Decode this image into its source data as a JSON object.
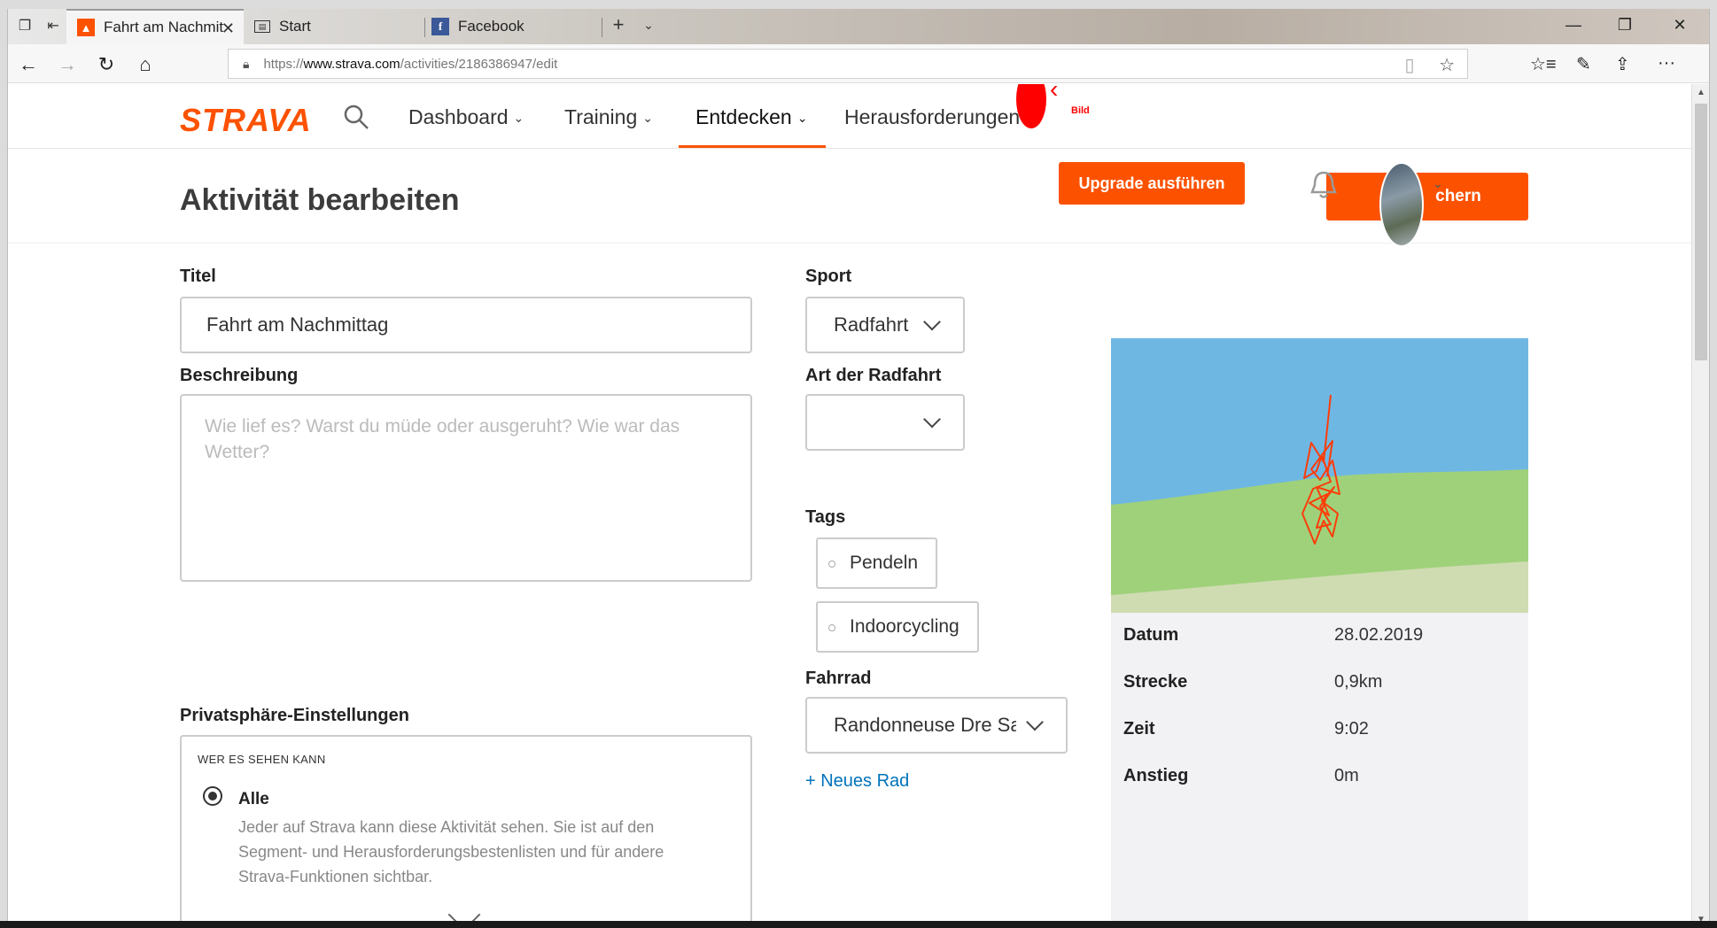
{
  "browser": {
    "tabs": [
      {
        "label": "Fahrt am Nachmittag | F",
        "active": true,
        "icon": "strava-favicon"
      },
      {
        "label": "Start",
        "active": false,
        "icon": "start-page-icon"
      },
      {
        "label": "Facebook",
        "active": false,
        "icon": "facebook-favicon"
      }
    ],
    "url_prefix": "https://",
    "url_host": "www.strava.com",
    "url_path": "/activities/2186386947/edit"
  },
  "nav": {
    "logo": "STRAVA",
    "items": [
      {
        "label": "Dashboard"
      },
      {
        "label": "Training"
      },
      {
        "label": "Entdecken"
      },
      {
        "label": "Herausforderungen"
      }
    ],
    "annotation_label": "Bild"
  },
  "header": {
    "title": "Aktivität bearbeiten",
    "upgrade_label": "Upgrade ausführen",
    "save_label": "Speichern",
    "save_visible_text": "chern"
  },
  "form": {
    "title_label": "Titel",
    "title_value": "Fahrt am Nachmittag",
    "description_label": "Beschreibung",
    "description_placeholder": "Wie lief es? Warst du müde oder ausgeruht? Wie war das Wetter?",
    "privacy_label": "Privatsphäre-Einstellungen",
    "privacy_heading": "WER ES SEHEN KANN",
    "privacy_option": "Alle",
    "privacy_desc": "Jeder auf Strava kann diese Aktivität sehen. Sie ist auf den Segment- und Herausforderungsbestenlisten und für andere Strava-Funktionen sichtbar.",
    "sport_label": "Sport",
    "sport_value": "Radfahrt",
    "ride_type_label": "Art der Radfahrt",
    "ride_type_value": "",
    "tags_label": "Tags",
    "tags": [
      "Pendeln",
      "Indoorcycling"
    ],
    "bike_label": "Fahrrad",
    "bike_value": "Randonneuse Dre Sa",
    "new_bike_link": "+ Neues Rad"
  },
  "stats": [
    {
      "key": "Datum",
      "value": "28.02.2019"
    },
    {
      "key": "Strecke",
      "value": "0,9km"
    },
    {
      "key": "Zeit",
      "value": "9:02"
    },
    {
      "key": "Anstieg",
      "value": "0m"
    }
  ],
  "colors": {
    "brand": "#fc5200",
    "map_water": "#6fb7e3",
    "map_land": "#9fd17a",
    "route": "#fc3d0a"
  }
}
